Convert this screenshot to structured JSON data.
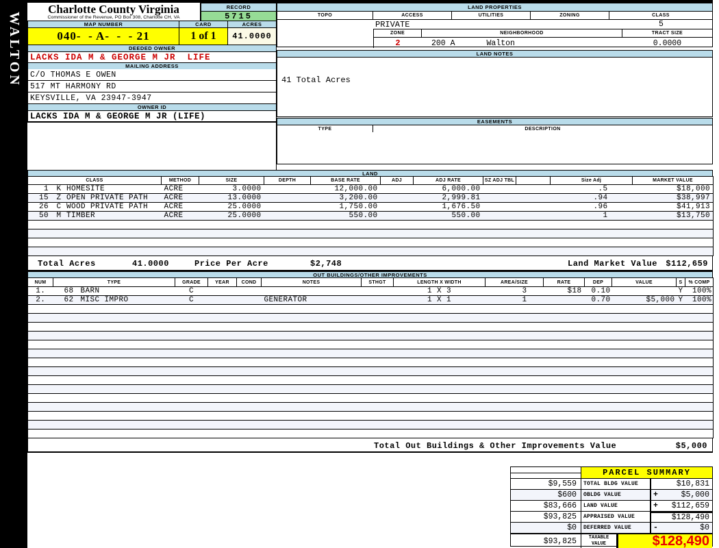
{
  "district_tab": "WALTON",
  "header": {
    "county": "Charlotte County Virginia",
    "commissioner_line": "Commissioner of the Revenue, PO Box 308, Charlotte CH, VA",
    "record_label": "RECORD",
    "record_value": "5715",
    "map_number_label": "MAP NUMBER",
    "map_number_value": "040-  - A-  -  - 21",
    "card_label": "CARD",
    "card_value": "1 of 1",
    "acres_label": "ACRES",
    "acres_value": "41.0000"
  },
  "owner": {
    "deeded_owner_label": "DEEDED OWNER",
    "deeded_owner": "LACKS IDA M & GEORGE M JR  LIFE",
    "mailing_address_label": "MAILING ADDRESS",
    "address_line1": "C/O THOMAS E OWEN",
    "address_line2": "517 MT HARMONY RD",
    "address_line3": "KEYSVILLE, VA 23947-3947",
    "owner_id_label": "OWNER ID",
    "owner_id": "LACKS IDA M & GEORGE M JR (LIFE)"
  },
  "land_properties": {
    "title": "LAND PROPERTIES",
    "col_topo": "TOPO",
    "col_access": "ACCESS",
    "col_utilities": "UTILITIES",
    "col_zoning": "ZONING",
    "col_class": "CLASS",
    "access_value": "PRIVATE",
    "class_value": "5",
    "zone_label": "ZONE",
    "zone_value": "2",
    "neighborhood_label": "NEIGHBORHOOD",
    "neighborhood_code": "200 A",
    "neighborhood_name": "Walton",
    "tract_size_label": "TRACT SIZE",
    "tract_size_value": "0.0000"
  },
  "land_notes": {
    "title": "LAND NOTES",
    "note": "41 Total Acres"
  },
  "easements": {
    "title": "EASEMENTS",
    "col_type": "TYPE",
    "col_description": "DESCRIPTION"
  },
  "land": {
    "title": "LAND",
    "columns": [
      "CLASS",
      "METHOD",
      "SIZE",
      "DEPTH",
      "BASE RATE",
      "ADJ",
      "ADJ RATE",
      "SZ ADJ TBL",
      "",
      "Size Adj",
      "MARKET VALUE"
    ],
    "rows": [
      {
        "num": "1",
        "code": "K",
        "name": "HOMESITE",
        "method": "ACRE",
        "size": "3.0000",
        "base_rate": "12,000.00",
        "adj_rate": "6,000.00",
        "size_adj": ".5",
        "market_value": "$18,000"
      },
      {
        "num": "15",
        "code": "Z",
        "name": "OPEN PRIVATE PATH",
        "method": "ACRE",
        "size": "13.0000",
        "base_rate": "3,200.00",
        "adj_rate": "2,999.81",
        "size_adj": ".94",
        "market_value": "$38,997"
      },
      {
        "num": "26",
        "code": "C",
        "name": "WOOD PRIVATE PATH",
        "method": "ACRE",
        "size": "25.0000",
        "base_rate": "1,750.00",
        "adj_rate": "1,676.50",
        "size_adj": ".96",
        "market_value": "$41,913"
      },
      {
        "num": "50",
        "code": "M",
        "name": "TIMBER",
        "method": "ACRE",
        "size": "25.0000",
        "base_rate": "550.00",
        "adj_rate": "550.00",
        "size_adj": "1",
        "market_value": "$13,750"
      }
    ],
    "total_acres_label": "Total Acres",
    "total_acres": "41.0000",
    "price_per_acre_label": "Price Per Acre",
    "price_per_acre": "$2,748",
    "land_market_value_label": "Land Market Value",
    "land_market_value": "$112,659"
  },
  "out_buildings": {
    "title": "OUT BUILDINGS/OTHER IMPROVEMENTS",
    "columns": [
      "NUM",
      "TYPE",
      "GRADE",
      "YEAR",
      "COND",
      "NOTES",
      "STHGT",
      "LENGTH X WIDTH",
      "AREA/SIZE",
      "RATE",
      "DEP",
      "VALUE",
      "S",
      "% COMP"
    ],
    "rows": [
      {
        "num": "1.",
        "type_code": "68",
        "type_name": "BARN",
        "grade": "C",
        "notes": "",
        "length_width": "1 X 3",
        "area_size": "3",
        "rate": "$18",
        "dep": "0.10",
        "value": "",
        "s": "Y",
        "pct_comp": "100%"
      },
      {
        "num": "2.",
        "type_code": "62",
        "type_name": "MISC IMPRO",
        "grade": "C",
        "notes": "GENERATOR",
        "length_width": "1 X 1",
        "area_size": "1",
        "rate": "",
        "dep": "0.70",
        "value": "$5,000",
        "s": "Y",
        "pct_comp": "100%"
      }
    ],
    "total_label": "Total Out Buildings & Other Improvements Value",
    "total_value": "$5,000"
  },
  "parcel_summary": {
    "title": "PARCEL SUMMARY",
    "rows": [
      {
        "prior": "$9,559",
        "label": "TOTAL BLDG VALUE",
        "op": "",
        "value": "$10,831"
      },
      {
        "prior": "$600",
        "label": "OBLDG VALUE",
        "op": "+",
        "value": "$5,000"
      },
      {
        "prior": "$83,666",
        "label": "LAND VALUE",
        "op": "+",
        "value": "$112,659"
      },
      {
        "prior": "$93,825",
        "label": "APPRAISED VALUE",
        "op": "",
        "value": "$128,490"
      },
      {
        "prior": "$0",
        "label": "DEFERRED VALUE",
        "op": "-",
        "value": "$0"
      }
    ],
    "taxable_prior": "$93,825",
    "taxable_label": "TAXABLE VALUE",
    "taxable_value": "$128,490"
  },
  "colors": {
    "band_blue": "#b9dcea",
    "highlight_yellow": "#ffff00",
    "record_green": "#96dc96",
    "acres_ivory": "#fbfae6",
    "owner_red": "#cc0000",
    "zone_red": "#cc0000",
    "taxable_red": "#e60000",
    "row_stripe": "#f3f5fb"
  }
}
